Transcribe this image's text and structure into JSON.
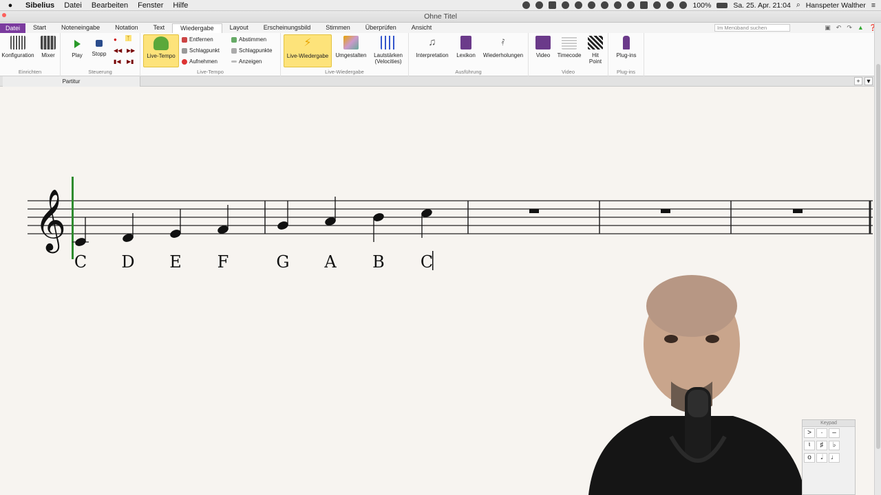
{
  "menubar": {
    "apple": "",
    "items": [
      "Sibelius",
      "Datei",
      "Bearbeiten",
      "Fenster",
      "Hilfe"
    ],
    "battery": "100%",
    "datetime": "Sa. 25. Apr. 21:04",
    "user": "Hanspeter Walther"
  },
  "window": {
    "title": "Ohne Titel"
  },
  "ribbon_tabs": [
    "Datei",
    "Start",
    "Noteneingabe",
    "Notation",
    "Text",
    "Wiedergabe",
    "Layout",
    "Erscheinungsbild",
    "Stimmen",
    "Überprüfen",
    "Ansicht"
  ],
  "active_tab": "Wiedergabe",
  "search": {
    "placeholder": "Im Menüband suchen"
  },
  "ribbon": {
    "einrichten": {
      "label": "Einrichten",
      "konfiguration": "Konfiguration",
      "mixer": "Mixer"
    },
    "steuerung": {
      "label": "Steuerung",
      "play": "Play",
      "stopp": "Stopp"
    },
    "live_tempo": {
      "label": "Live-Tempo",
      "live_tempo_btn": "Live-Tempo",
      "entfernen": "Entfernen",
      "schlagpunkt": "Schlagpunkt",
      "aufnehmen": "Aufnehmen",
      "abstimmen": "Abstimmen",
      "schlagpunkte": "Schlagpunkte",
      "anzeigen": "Anzeigen"
    },
    "live_wiedergabe": {
      "label": "Live-Wiedergabe",
      "live_wiedergabe_btn": "Live-Wiedergabe",
      "umgestalten": "Umgestalten",
      "lautstaerken": "Lautstärken",
      "velocities": "(Velocities)"
    },
    "ausfuehrung": {
      "label": "Ausführung",
      "interpretation": "Interpretation",
      "lexikon": "Lexikon",
      "wiederholungen": "Wiederholungen"
    },
    "video": {
      "label": "Video",
      "video_btn": "Video",
      "timecode": "Timecode",
      "hit": "Hit",
      "point": "Point"
    },
    "plugins": {
      "label": "Plug-ins",
      "plugins_btn": "Plug-ins"
    }
  },
  "document": {
    "tab": "Partitur"
  },
  "score": {
    "clef": "treble",
    "notes": [
      "C",
      "D",
      "E",
      "F",
      "G",
      "A",
      "B",
      "C"
    ],
    "lyrics": [
      "C",
      "D",
      "E",
      "F",
      "G",
      "A",
      "B",
      "C"
    ],
    "rest_bars": 3
  },
  "keypad": {
    "title": "Keypad"
  },
  "colors": {
    "accent": "#7b3b9e",
    "highlight": "#fde37a",
    "playline": "#2e8b2e"
  }
}
